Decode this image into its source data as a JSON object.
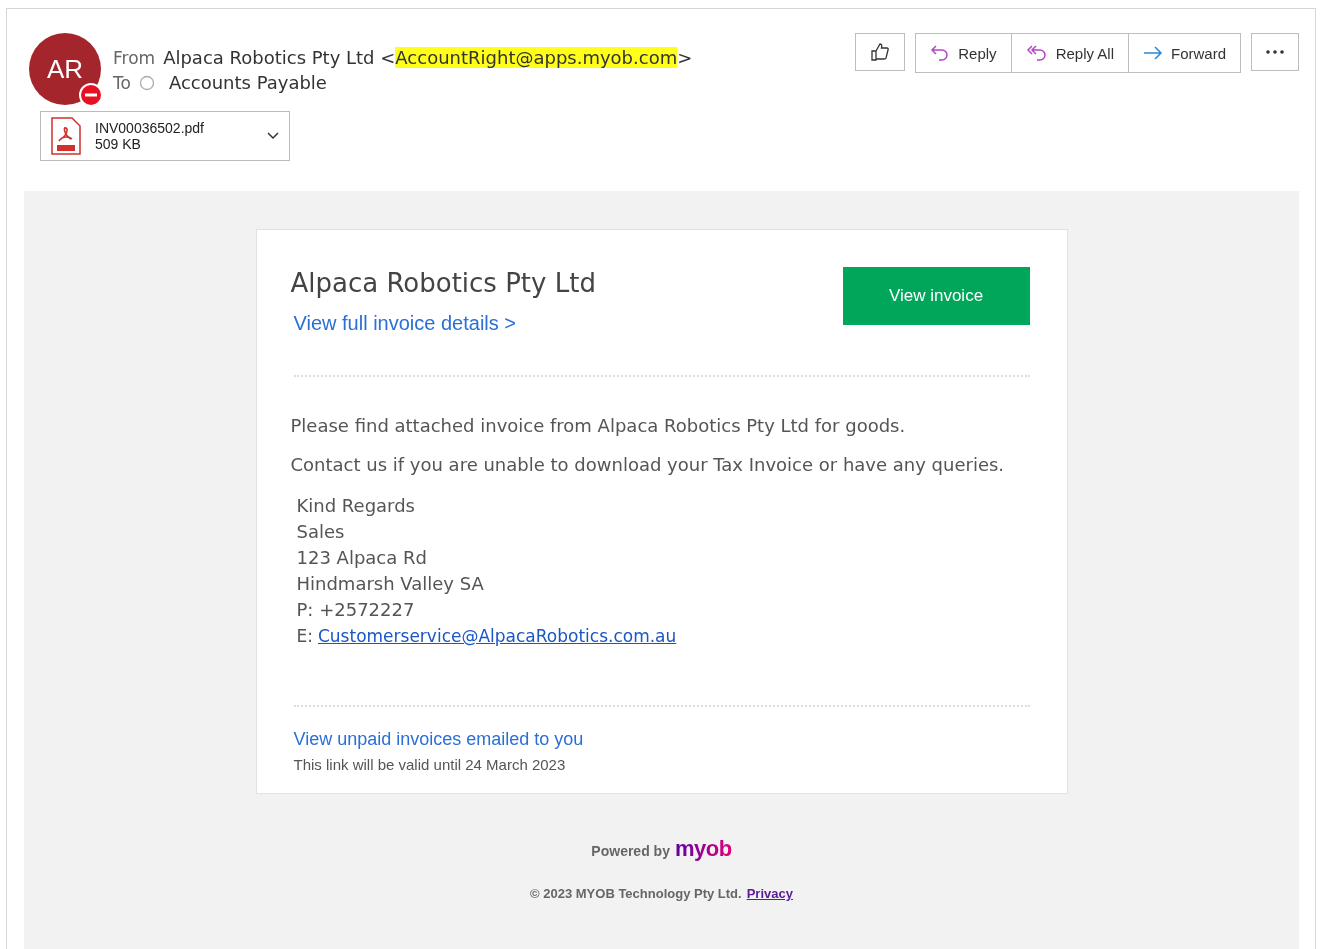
{
  "header": {
    "avatar": {
      "initials": "AR"
    },
    "from": {
      "label": "From",
      "name": "Alpaca Robotics Pty Ltd <",
      "address": "AccountRight@apps.myob.com",
      "suffix": ">",
      "highlighted": true
    },
    "to": {
      "label": "To",
      "recipient": "Accounts Payable"
    },
    "attachment": {
      "name": "INV00036502.pdf",
      "size": "509 KB"
    },
    "actions": [
      {
        "kind": "like"
      },
      {
        "kind": "reply",
        "label": "Reply"
      },
      {
        "kind": "reply-all",
        "label": "Reply All"
      },
      {
        "kind": "forward",
        "label": "Forward"
      },
      {
        "kind": "more"
      }
    ]
  },
  "card": {
    "company": "Alpaca Robotics Pty Ltd",
    "details_link": "View full invoice details >",
    "button": "View invoice",
    "paragraphs": [
      "Please find attached invoice from Alpaca Robotics Pty Ltd for goods.",
      "Contact us if you are unable to download your Tax Invoice or have any queries."
    ],
    "signature": [
      "Kind Regards",
      "Sales",
      "123 Alpaca Rd",
      "Hindmarsh Valley SA",
      "P: +2572227"
    ],
    "email": {
      "label": "E:",
      "address": "Customerservice@AlpacaRobotics.com.au"
    },
    "unpaid_link": "View unpaid invoices emailed to you",
    "validity": "This link will be valid until 24 March 2023"
  },
  "footer": {
    "powered_by": "Powered by",
    "logo": "myob",
    "copyright": "© 2023 MYOB Technology Pty Ltd.",
    "privacy": "Privacy"
  }
}
